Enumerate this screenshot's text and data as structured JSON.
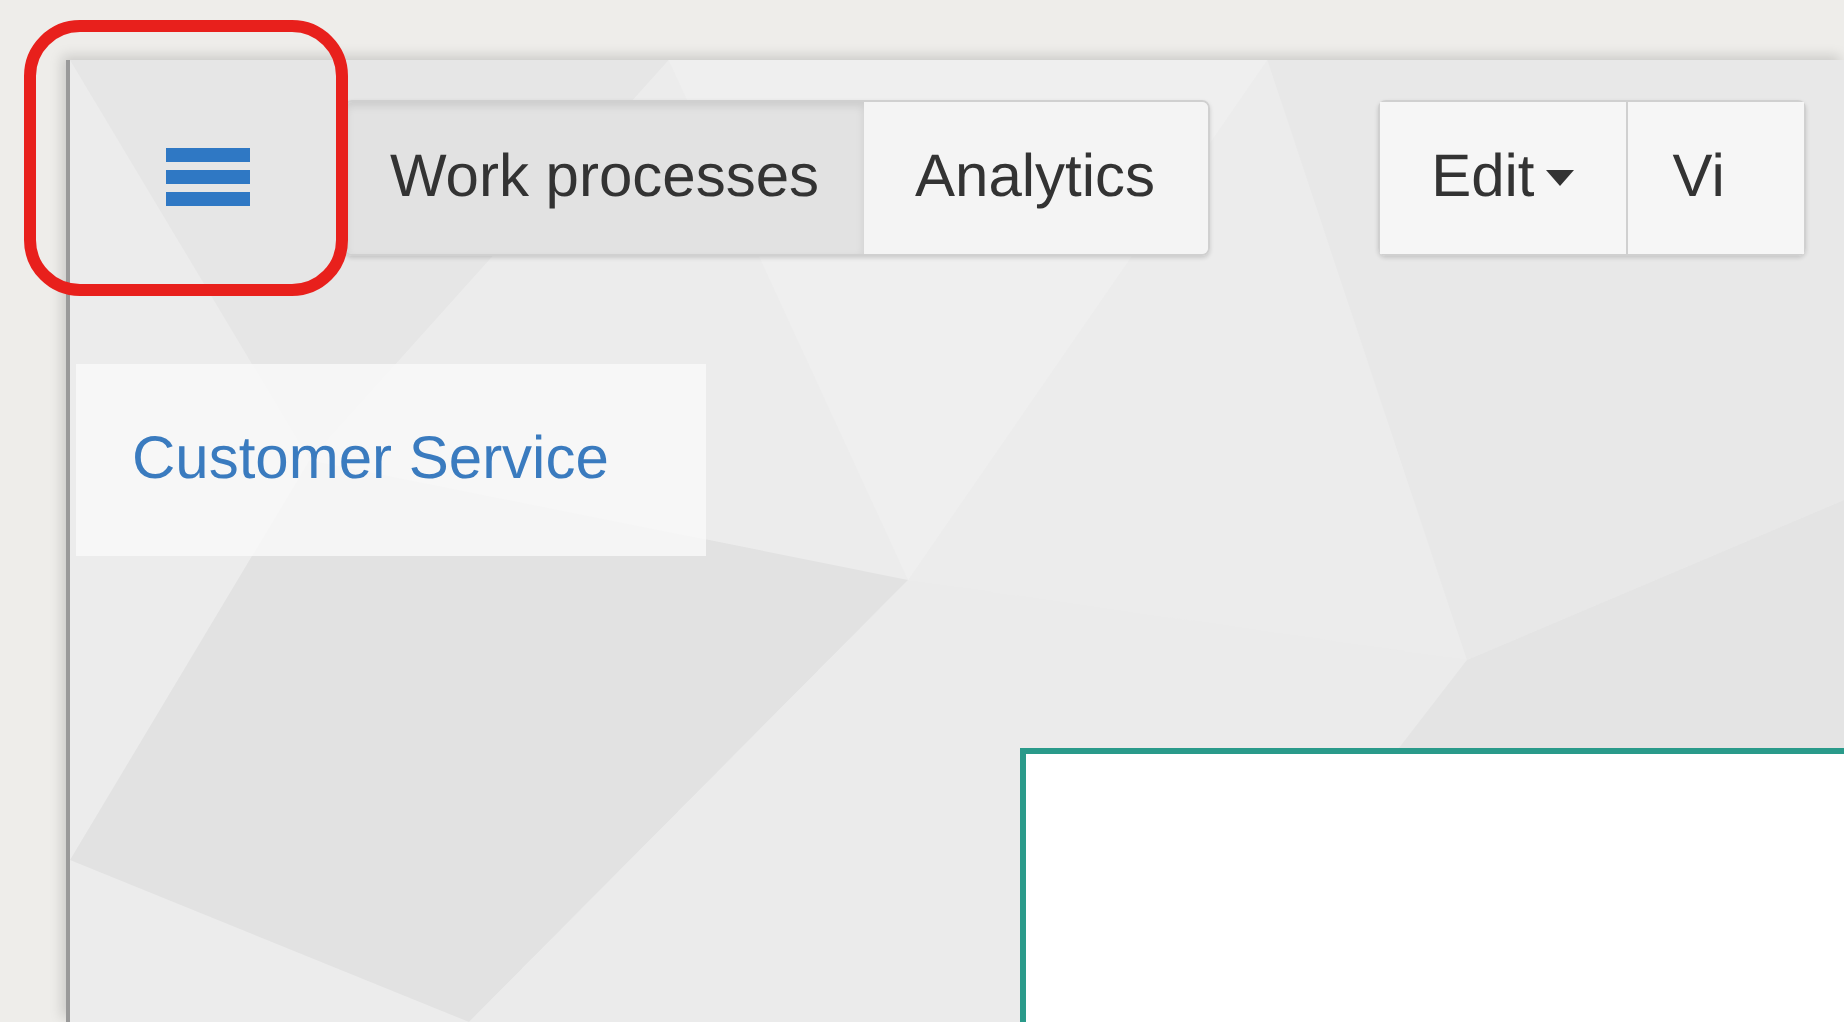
{
  "tabs": [
    {
      "label": "Work processes",
      "selected": true
    },
    {
      "label": "Analytics",
      "selected": false
    }
  ],
  "toolbar_buttons": [
    {
      "label": "Edit",
      "kind": "dropdown"
    },
    {
      "label": "Vi",
      "kind": "plain"
    }
  ],
  "sidebar": {
    "items": [
      {
        "label": "Customer Service"
      }
    ]
  }
}
